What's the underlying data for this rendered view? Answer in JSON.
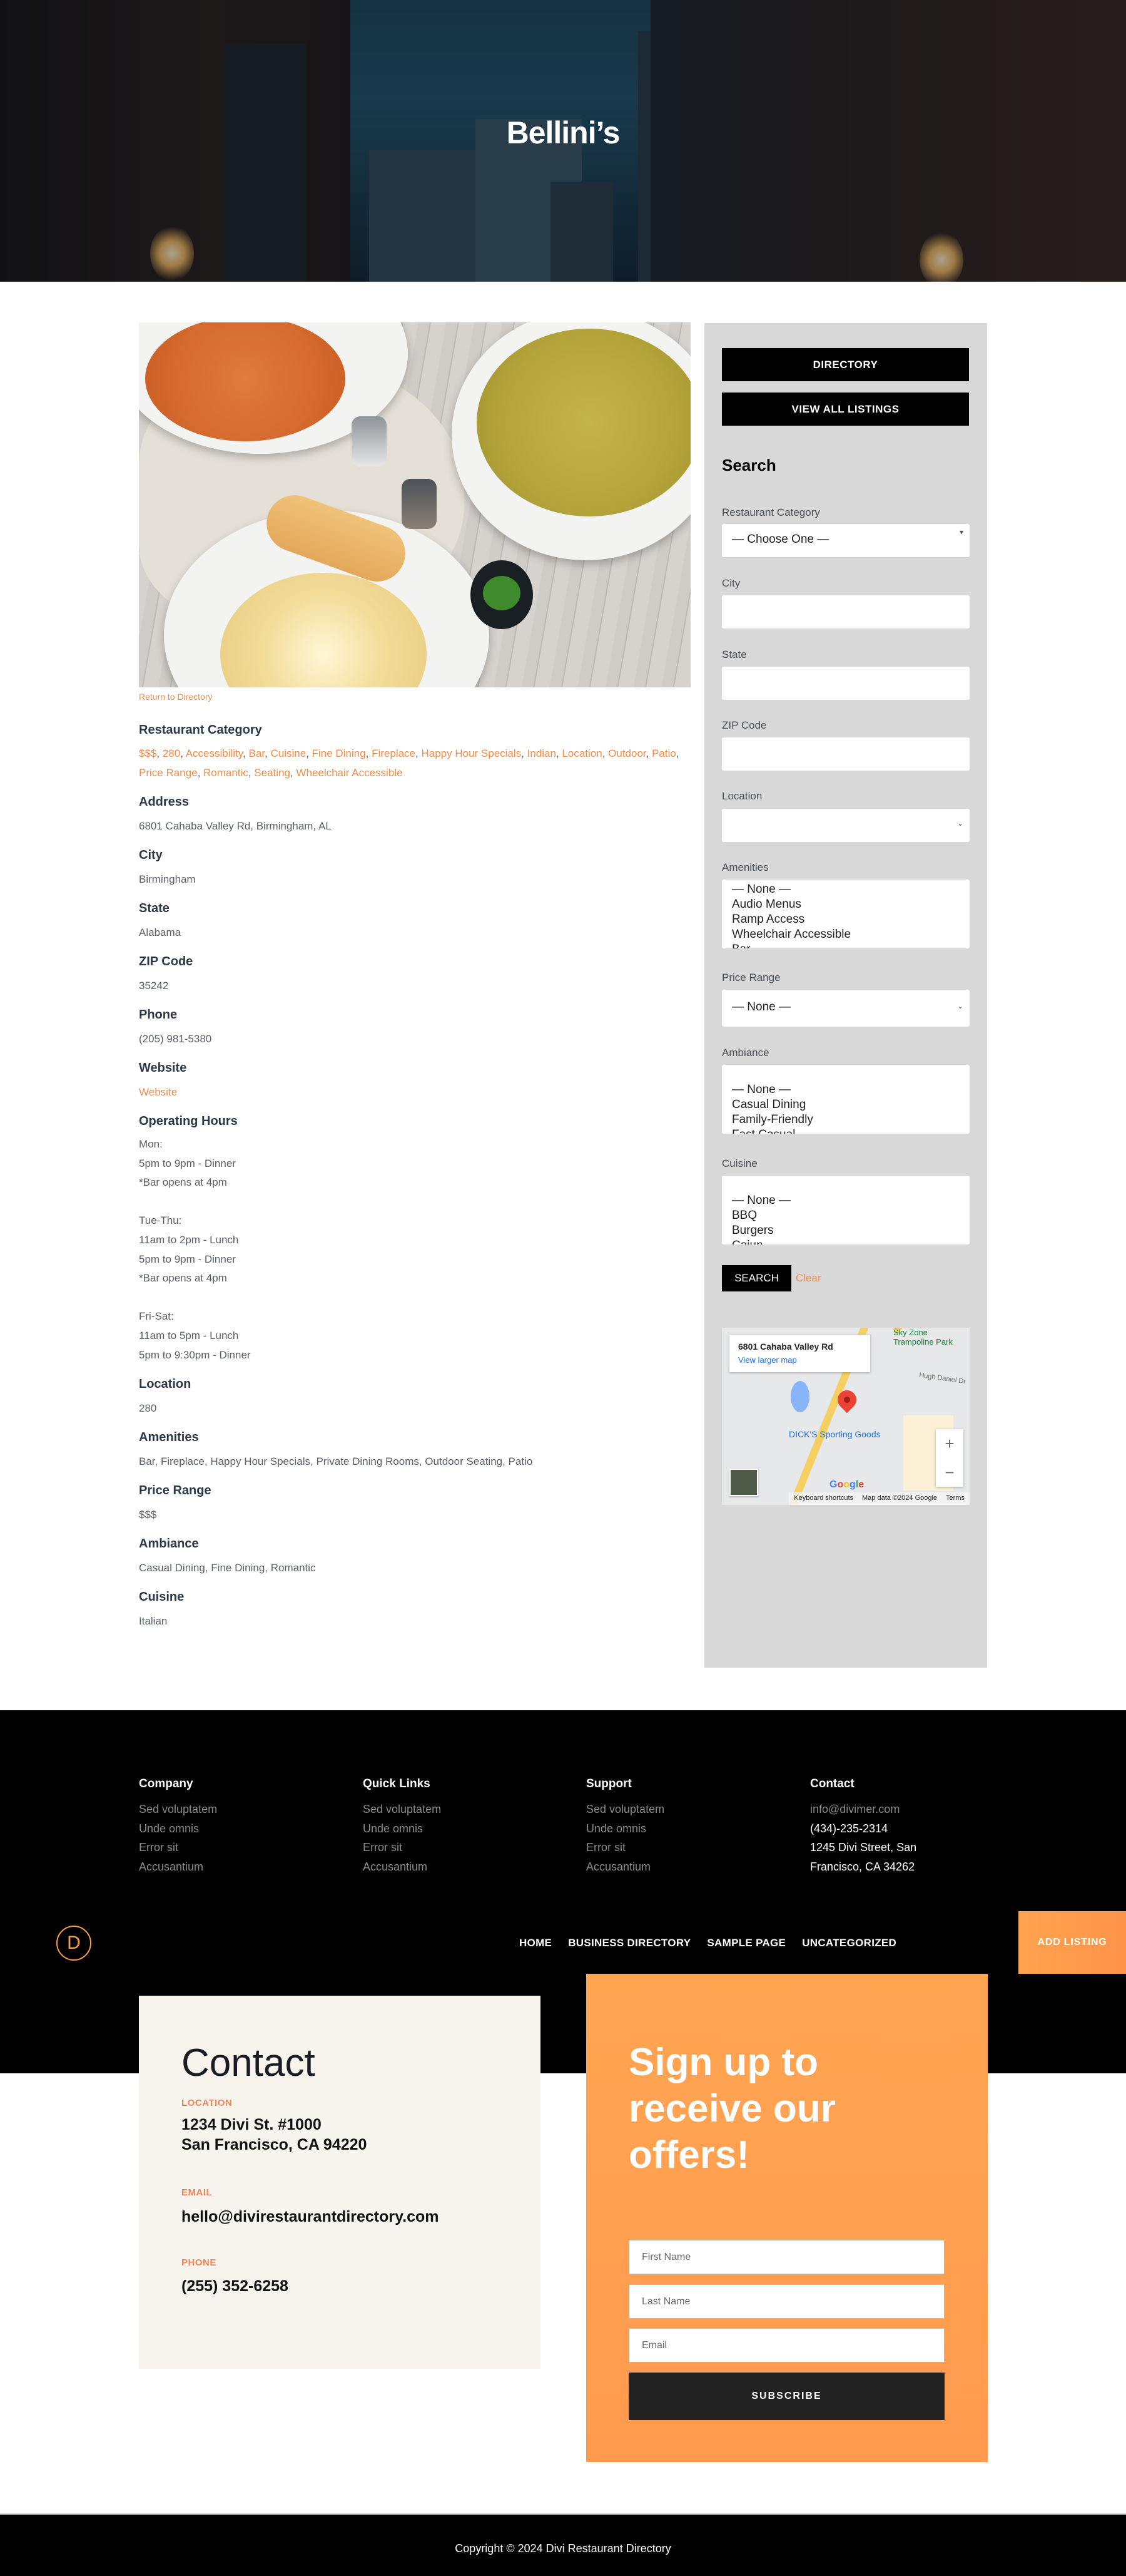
{
  "hero": {
    "title": "Bellini’s"
  },
  "listing": {
    "return_link": "Return to Directory",
    "category": {
      "label": "Restaurant Category",
      "items": [
        "$$$",
        "280",
        "Accessibility",
        "Bar",
        "Cuisine",
        "Fine Dining",
        "Fireplace",
        "Happy Hour Specials",
        "Indian",
        "Location",
        "Outdoor",
        "Patio",
        "Price Range",
        "Romantic",
        "Seating",
        "Wheelchair Accessible"
      ]
    },
    "fields": [
      {
        "label": "Address",
        "value": "6801 Cahaba Valley Rd, Birmingham, AL"
      },
      {
        "label": "City",
        "value": "Birmingham"
      },
      {
        "label": "State",
        "value": "Alabama"
      },
      {
        "label": "ZIP Code",
        "value": "35242"
      },
      {
        "label": "Phone",
        "value": "(205) 981-5380"
      },
      {
        "label": "Website",
        "value": "Website"
      }
    ],
    "hours": {
      "label": "Operating Hours",
      "lines": [
        "Mon:",
        "5pm to 9pm - Dinner",
        "*Bar opens at 4pm",
        "",
        "Tue-Thu:",
        "11am to 2pm - Lunch",
        "5pm to 9pm - Dinner",
        "*Bar opens at 4pm",
        "",
        "Fri-Sat:",
        "11am to 5pm - Lunch",
        "5pm to 9:30pm - Dinner"
      ]
    },
    "fields2": [
      {
        "label": "Location",
        "value": "280"
      },
      {
        "label": "Amenities",
        "value": "Bar, Fireplace, Happy Hour Specials, Private Dining Rooms, Outdoor Seating, Patio"
      },
      {
        "label": "Price Range",
        "value": "$$$"
      },
      {
        "label": "Ambiance",
        "value": "Casual Dining, Fine Dining, Romantic"
      },
      {
        "label": "Cuisine",
        "value": "Italian"
      }
    ]
  },
  "sidebar": {
    "directory_button": "DIRECTORY",
    "view_all_button": "VIEW ALL LISTINGS",
    "search_title": "Search",
    "restaurant_category": {
      "label": "Restaurant Category",
      "value": "— Choose One —"
    },
    "city": {
      "label": "City",
      "value": ""
    },
    "state": {
      "label": "State",
      "value": ""
    },
    "zip": {
      "label": "ZIP Code",
      "value": ""
    },
    "location": {
      "label": "Location",
      "value": ""
    },
    "amenities": {
      "label": "Amenities",
      "options": [
        "— None —",
        "Audio Menus",
        "Ramp Access",
        "Wheelchair Accessible",
        "Bar"
      ]
    },
    "price_range": {
      "label": "Price Range",
      "value": "— None —"
    },
    "ambiance": {
      "label": "Ambiance",
      "options": [
        "— None —",
        "Casual Dining",
        "Family-Friendly",
        "Fast Casual"
      ]
    },
    "cuisine": {
      "label": "Cuisine",
      "options": [
        "— None —",
        "BBQ",
        "Burgers",
        "Cajun"
      ]
    },
    "search_button": "SEARCH",
    "clear_link": "Clear",
    "map": {
      "address": "6801 Cahaba Valley Rd",
      "larger_link": "View larger map",
      "poi": "DICK'S Sporting Goods",
      "poi2": "Sky Zone Trampoline Park",
      "road_label": "Hugh Daniel Dr",
      "zoom_in": "+",
      "zoom_out": "−",
      "google": "Google",
      "keyboard": "Keyboard shortcuts",
      "map_data": "Map data ©2024 Google",
      "terms": "Terms"
    }
  },
  "footer": {
    "columns": [
      {
        "title": "Company",
        "items": [
          "Sed voluptatem",
          "Unde omnis",
          "Error sit",
          "Accusantium"
        ]
      },
      {
        "title": "Quick Links",
        "items": [
          "Sed voluptatem",
          "Unde omnis",
          "Error sit",
          "Accusantium"
        ]
      },
      {
        "title": "Support",
        "items": [
          "Sed voluptatem",
          "Unde omnis",
          "Error sit",
          "Accusantium"
        ]
      },
      {
        "title": "Contact",
        "items": [
          "info@divimer.com",
          "(434)-235-2314",
          "1245 Divi Street, San",
          "Francisco, CA 34262"
        ]
      }
    ]
  },
  "nav": {
    "logo_letter": "D",
    "links": [
      "HOME",
      "BUSINESS DIRECTORY",
      "SAMPLE PAGE",
      "UNCATEGORIZED"
    ],
    "add_listing": "ADD LISTING"
  },
  "contact": {
    "title": "Contact",
    "location_label": "LOCATION",
    "location_line1": "1234 Divi St. #1000",
    "location_line2": "San Francisco, CA 94220",
    "email_label": "EMAIL",
    "email": "hello@divirestaurantdirectory.com",
    "phone_label": "PHONE",
    "phone": "(255) 352-6258"
  },
  "signup": {
    "title": "Sign up to receive our offers!",
    "first_name_placeholder": "First Name",
    "last_name_placeholder": "Last Name",
    "email_placeholder": "Email",
    "subscribe": "SUBSCRIBE"
  },
  "copyright": "Copyright © 2024 Divi Restaurant Directory",
  "colors": {
    "accent": "#f28c4a",
    "signup_bg": "#ff9d4f",
    "sidebar_bg": "#d8d8d8",
    "contact_bg": "#f7f4ee"
  }
}
